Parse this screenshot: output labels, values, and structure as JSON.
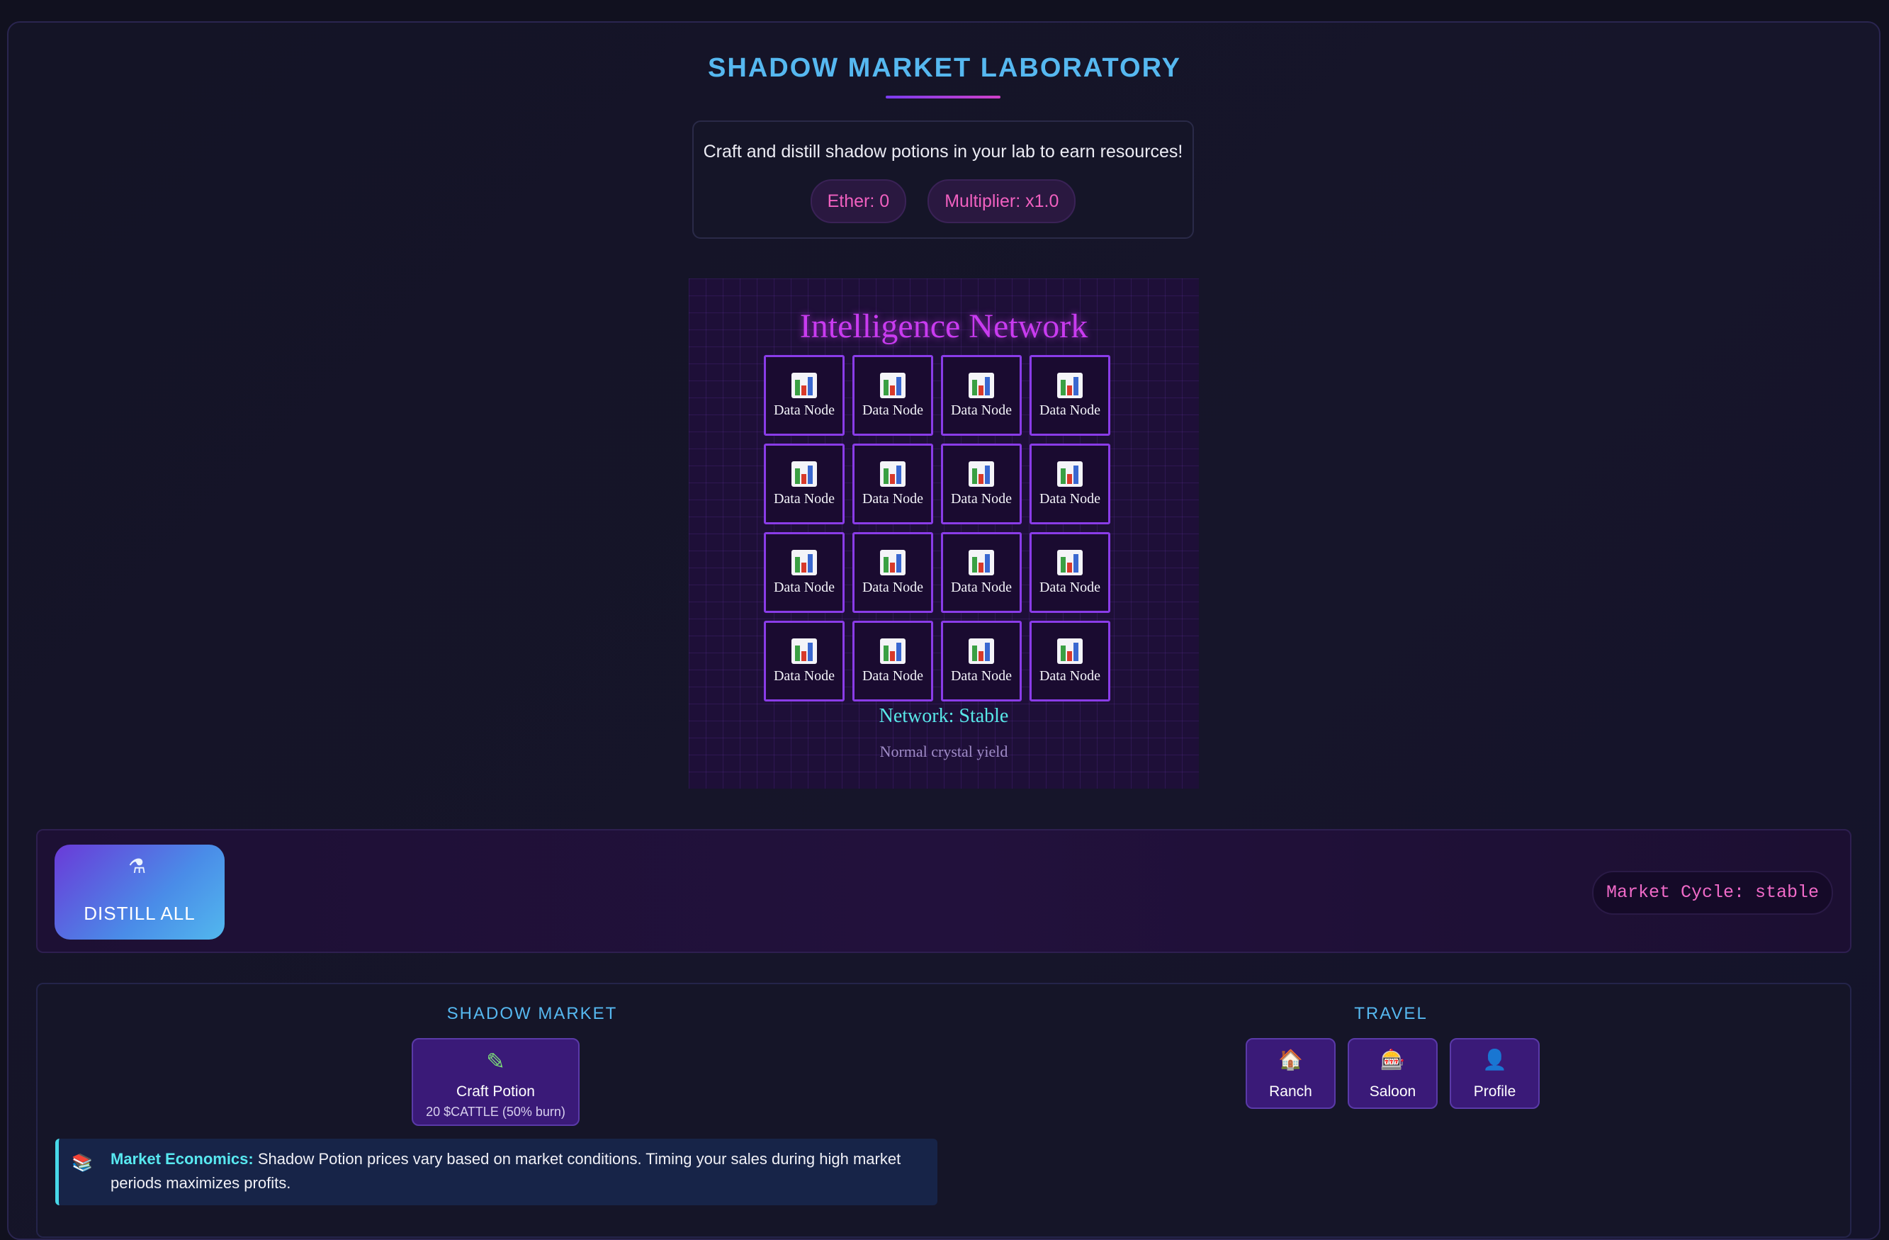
{
  "header": {
    "title": "SHADOW MARKET LABORATORY",
    "subtitle": "Craft and distill shadow potions in your lab to earn resources!",
    "ether": "Ether: 0",
    "multiplier": "Multiplier: x1.0"
  },
  "network": {
    "title": "Intelligence Network",
    "nodes": [
      "Data Node",
      "Data Node",
      "Data Node",
      "Data Node",
      "Data Node",
      "Data Node",
      "Data Node",
      "Data Node",
      "Data Node",
      "Data Node",
      "Data Node",
      "Data Node",
      "Data Node",
      "Data Node",
      "Data Node",
      "Data Node"
    ],
    "node_icon": "bar-chart-icon",
    "status": "Network: Stable",
    "yield": "Normal crystal yield"
  },
  "actions": {
    "distill_icon": "flask-icon",
    "distill_label": "DISTILL ALL",
    "market_cycle": "Market Cycle: stable"
  },
  "market": {
    "heading": "SHADOW MARKET",
    "craft_icon": "test-tube-icon",
    "craft_label": "Craft Potion",
    "craft_cost": "20 $CATTLE (50% burn)",
    "economics_icon": "books-icon",
    "economics_title": "Market Economics:",
    "economics_text": " Shadow Potion prices vary based on market conditions. Timing your sales during high market periods maximizes profits."
  },
  "travel": {
    "heading": "TRAVEL",
    "buttons": [
      {
        "label": "Ranch",
        "icon": "house-icon"
      },
      {
        "label": "Saloon",
        "icon": "slot-machine-icon"
      },
      {
        "label": "Profile",
        "icon": "user-icon"
      }
    ]
  },
  "colors": {
    "accent": "#56b8f0",
    "pink": "#f060c0",
    "network_title": "#c93bf0",
    "status_cyan": "#58e8e8",
    "button_purple": "#3a1a78"
  }
}
